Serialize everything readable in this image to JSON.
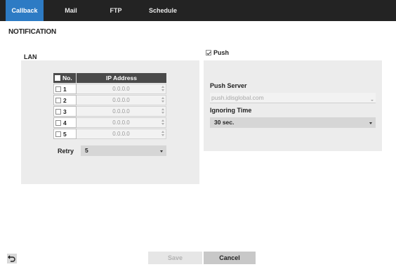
{
  "tabs": [
    {
      "label": "Callback",
      "active": true
    },
    {
      "label": "Mail",
      "active": false
    },
    {
      "label": "FTP",
      "active": false
    },
    {
      "label": "Schedule",
      "active": false
    }
  ],
  "page_title": "NOTIFICATION",
  "lan": {
    "label": "LAN",
    "table": {
      "col_no": "No.",
      "col_ip": "IP Address",
      "rows": [
        {
          "no": "1",
          "ip": "0.0.0.0",
          "checked": false
        },
        {
          "no": "2",
          "ip": "0.0.0.0",
          "checked": false
        },
        {
          "no": "3",
          "ip": "0.0.0.0",
          "checked": false
        },
        {
          "no": "4",
          "ip": "0.0.0.0",
          "checked": false
        },
        {
          "no": "5",
          "ip": "0.0.0.0",
          "checked": false
        }
      ]
    },
    "retry_label": "Retry",
    "retry_value": "5"
  },
  "push": {
    "label": "Push",
    "checked": true,
    "server_label": "Push Server",
    "server_value": "push.idisglobal.com",
    "ignoring_label": "Ignoring Time",
    "ignoring_value": "30 sec."
  },
  "footer": {
    "save_label": "Save",
    "cancel_label": "Cancel"
  },
  "colors": {
    "tab_bar": "#232323",
    "tab_active": "#2d7bc4",
    "panel": "#ececec"
  }
}
